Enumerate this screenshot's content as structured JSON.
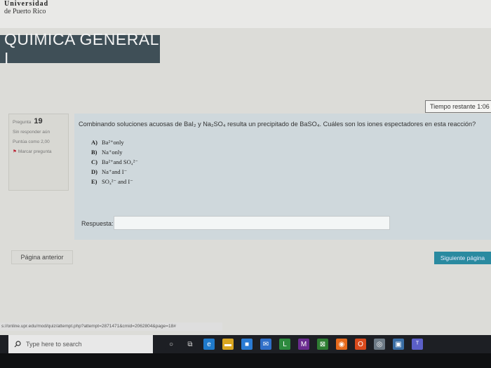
{
  "header": {
    "university_line1": "Universidad",
    "university_line2": "de Puerto Rico",
    "course_title": "QUIMICA GENERAL I"
  },
  "timer": {
    "label": "Tiempo restante 1:06"
  },
  "question_info": {
    "label": "Pregunta",
    "number": "19",
    "status": "Sin responder aún",
    "score": "Puntúa como 2,00",
    "flag_label": "Marcar pregunta"
  },
  "question": {
    "text": "Combinando soluciones acuosas de BaI₂ y Na₂SO₄ resulta un precipitado de BaSO₄. Cuáles son los iones espectadores en esta reacción?",
    "options": [
      {
        "letter": "A)",
        "text": "Ba²⁺only"
      },
      {
        "letter": "B)",
        "text": "Na⁺only"
      },
      {
        "letter": "C)",
        "text": "Ba²⁺and SO₄²⁻"
      },
      {
        "letter": "D)",
        "text": "Na⁺and I⁻"
      },
      {
        "letter": "E)",
        "text": "SO₄²⁻ and I⁻"
      }
    ],
    "answer_label": "Respuesta:",
    "answer_value": ""
  },
  "navigation": {
    "prev_label": "Página anterior",
    "next_label": "Siguiente página"
  },
  "status_url": "s://online.upr.edu/mod/quiz/attempt.php?attempt=2871471&cmid=2062804&page=18#",
  "taskbar": {
    "search_placeholder": "Type here to search",
    "icons": [
      {
        "name": "cortana-icon",
        "glyph": "○",
        "color": "#1d1f24"
      },
      {
        "name": "task-view-icon",
        "glyph": "⧉",
        "color": "#1d1f24"
      },
      {
        "name": "edge-icon",
        "glyph": "e",
        "color": "#1f7acb"
      },
      {
        "name": "file-explorer-icon",
        "glyph": "▬",
        "color": "#d9a520"
      },
      {
        "name": "store-icon",
        "glyph": "■",
        "color": "#2a7bd4"
      },
      {
        "name": "mail-icon",
        "glyph": "✉",
        "color": "#2f6fc8"
      },
      {
        "name": "app-icon",
        "glyph": "L",
        "color": "#2d8a3e"
      },
      {
        "name": "media-icon",
        "glyph": "M",
        "color": "#6a2b8f"
      },
      {
        "name": "xbox-icon",
        "glyph": "⊠",
        "color": "#2e7d32"
      },
      {
        "name": "firefox-icon",
        "glyph": "◉",
        "color": "#e66a1c"
      },
      {
        "name": "office-icon",
        "glyph": "O",
        "color": "#d94a1c"
      },
      {
        "name": "chrome-icon",
        "glyph": "◎",
        "color": "#6d7a86"
      },
      {
        "name": "camera-icon",
        "glyph": "▣",
        "color": "#3a6ea5"
      },
      {
        "name": "teams-icon",
        "glyph": "ᵀ",
        "color": "#5b5fc7"
      }
    ]
  }
}
